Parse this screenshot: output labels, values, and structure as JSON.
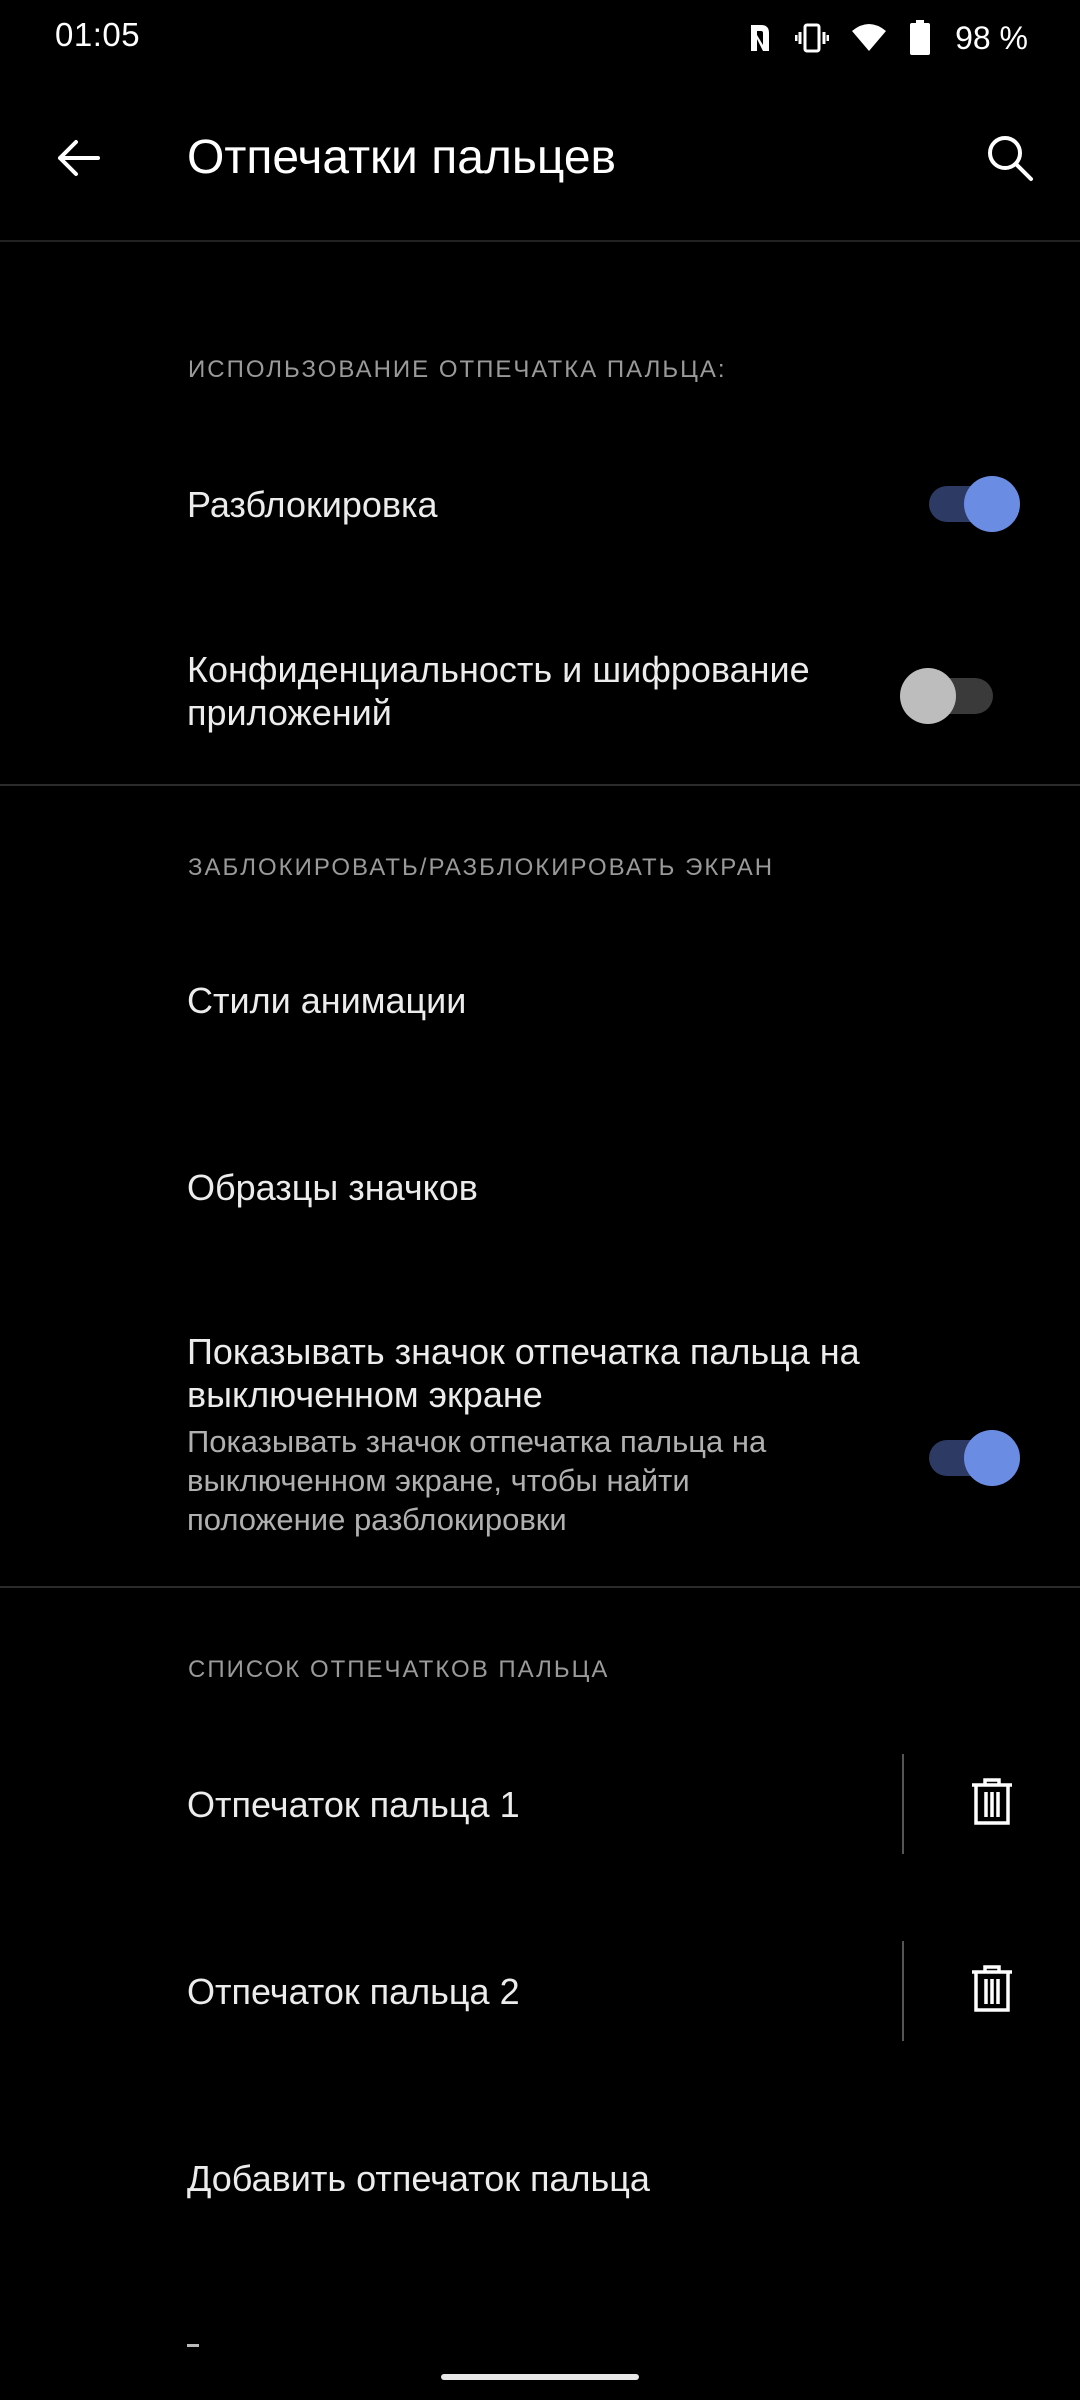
{
  "status_bar": {
    "time": "01:05",
    "battery_percent": "98 %",
    "icons": [
      "nfc-icon",
      "vibrate-icon",
      "wifi-icon",
      "battery-icon"
    ]
  },
  "app_bar": {
    "title": "Отпечатки пальцев",
    "back_icon": "arrow-left-icon",
    "search_icon": "search-icon"
  },
  "sections": {
    "usage": {
      "header": "ИСПОЛЬЗОВАНИЕ ОТПЕЧАТКА ПАЛЬЦА:",
      "unlock": {
        "title": "Разблокировка",
        "enabled": true
      },
      "privacy": {
        "title": "Конфиденциальность и шифрование приложений",
        "enabled": false
      }
    },
    "lock_screen": {
      "header": "ЗАБЛОКИРОВАТЬ/РАЗБЛОКИРОВАТЬ ЭКРАН",
      "animation_styles": {
        "title": "Стили анимации"
      },
      "icon_samples": {
        "title": "Образцы значков"
      },
      "show_icon": {
        "title": "Показывать значок отпечатка пальца на выключенном экране",
        "summary": "Показывать значок отпечатка пальца на выключенном экране, чтобы найти положение разблокировки",
        "enabled": true
      }
    },
    "fingerprints": {
      "header": "СПИСОК ОТПЕЧАТКОВ ПАЛЬЦА",
      "items": [
        {
          "name": "Отпечаток пальца 1"
        },
        {
          "name": "Отпечаток пальца 2"
        }
      ],
      "add": "Добавить отпечаток пальца"
    }
  },
  "colors": {
    "accent": "#6b8ce3",
    "accent_track": "#2d3a63",
    "background": "#000000",
    "section_header": "#9a9a9a"
  }
}
